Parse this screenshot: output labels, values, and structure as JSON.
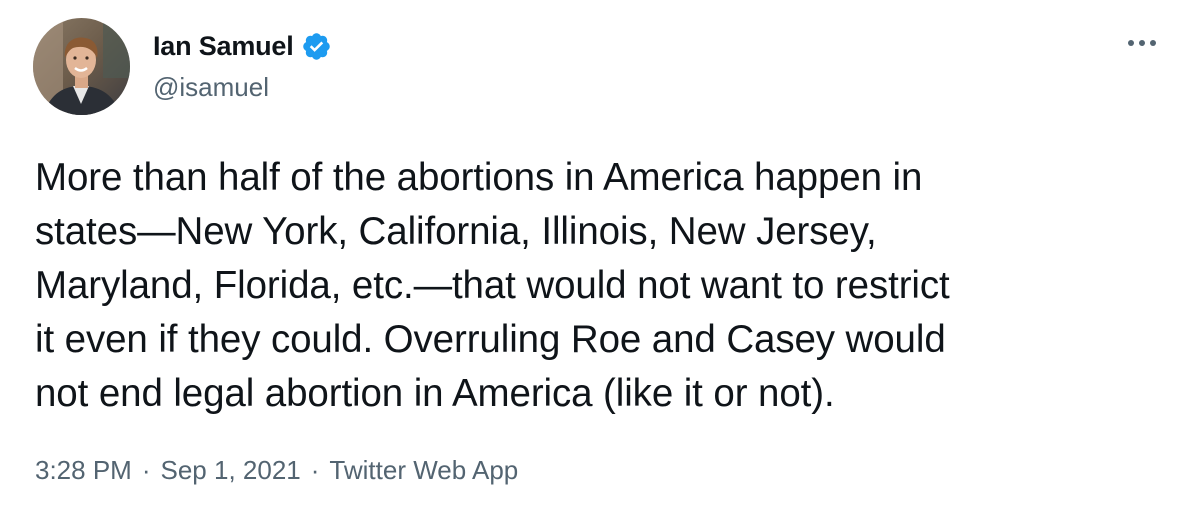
{
  "tweet": {
    "author": {
      "display_name": "Ian Samuel",
      "handle": "@isamuel",
      "verified": true,
      "avatar_icon": "profile-photo"
    },
    "more_icon": "more-horizontal-icon",
    "text": "More than half of the abortions in America happen in\nstates—New York, California, Illinois, New Jersey,\nMaryland, Florida, etc.—that would not want to restrict\nit even if they could. Overruling Roe and Casey would\nnot end legal abortion in America (like it or not).",
    "meta": {
      "time": "3:28 PM",
      "separator": "·",
      "date": "Sep 1, 2021",
      "source": "Twitter Web App"
    }
  },
  "colors": {
    "text": "#0f1419",
    "secondary": "#536471",
    "verified_blue": "#1d9bf0"
  }
}
